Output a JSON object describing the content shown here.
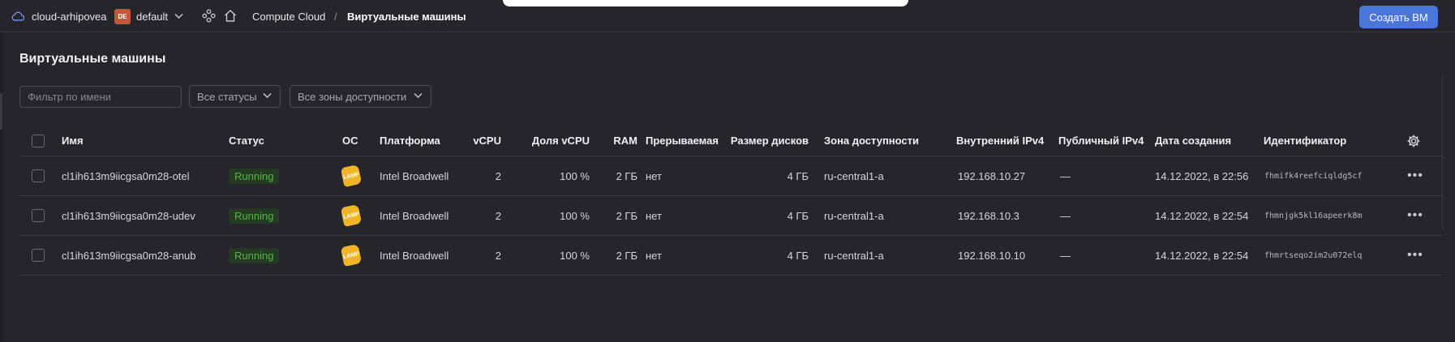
{
  "header": {
    "cloud_name": "cloud-arhipovea",
    "folder_badge": "DE",
    "folder_name": "default",
    "breadcrumb_service": "Compute Cloud",
    "breadcrumb_separator": "/",
    "breadcrumb_current": "Виртуальные машины",
    "create_button": "Создать ВМ"
  },
  "page": {
    "title": "Виртуальные машины"
  },
  "filters": {
    "name_placeholder": "Фильтр по имени",
    "status_select": "Все статусы",
    "zone_select": "Все зоны доступности"
  },
  "table": {
    "columns": {
      "name": "Имя",
      "status": "Статус",
      "os": "ОС",
      "platform": "Платформа",
      "vcpu": "vCPU",
      "vcpu_share": "Доля vCPU",
      "ram": "RAM",
      "preemptible": "Прерываемая",
      "disk_size": "Размер дисков",
      "zone": "Зона доступности",
      "internal_ip": "Внутренний IPv4",
      "public_ip": "Публичный IPv4",
      "created": "Дата создания",
      "id": "Идентификатор"
    },
    "rows": [
      {
        "name": "cl1ih613m9iicgsa0m28-otel",
        "status": "Running",
        "os": "LAMP",
        "platform": "Intel Broadwell",
        "vcpu": "2",
        "vcpu_share": "100 %",
        "ram": "2 ГБ",
        "preemptible": "нет",
        "disk_size": "4 ГБ",
        "zone": "ru-central1-a",
        "internal_ip": "192.168.10.27",
        "public_ip": "—",
        "created": "14.12.2022, в 22:56",
        "id": "fhmifk4reefciqldg5cf"
      },
      {
        "name": "cl1ih613m9iicgsa0m28-udev",
        "status": "Running",
        "os": "LAMP",
        "platform": "Intel Broadwell",
        "vcpu": "2",
        "vcpu_share": "100 %",
        "ram": "2 ГБ",
        "preemptible": "нет",
        "disk_size": "4 ГБ",
        "zone": "ru-central1-a",
        "internal_ip": "192.168.10.3",
        "public_ip": "—",
        "created": "14.12.2022, в 22:54",
        "id": "fhmnjgk5kl16apeerk8m"
      },
      {
        "name": "cl1ih613m9iicgsa0m28-anub",
        "status": "Running",
        "os": "LAMP",
        "platform": "Intel Broadwell",
        "vcpu": "2",
        "vcpu_share": "100 %",
        "ram": "2 ГБ",
        "preemptible": "нет",
        "disk_size": "4 ГБ",
        "zone": "ru-central1-a",
        "internal_ip": "192.168.10.10",
        "public_ip": "—",
        "created": "14.12.2022, в 22:54",
        "id": "fhmrtseqo2im2u072elq"
      }
    ],
    "row_menu": "•••"
  },
  "colors": {
    "background": "#26252b",
    "accent": "#4a76d9",
    "status_running_text": "#54b546",
    "status_running_bg": "#243a22",
    "folder_badge": "#c9543c",
    "os_badge": "#f0b429"
  },
  "icons": {
    "cloud": "cloud-icon",
    "services": "services-icon",
    "home": "home-icon",
    "chevron": "chevron-down-icon",
    "settings": "gear-icon",
    "more": "more-icon"
  }
}
